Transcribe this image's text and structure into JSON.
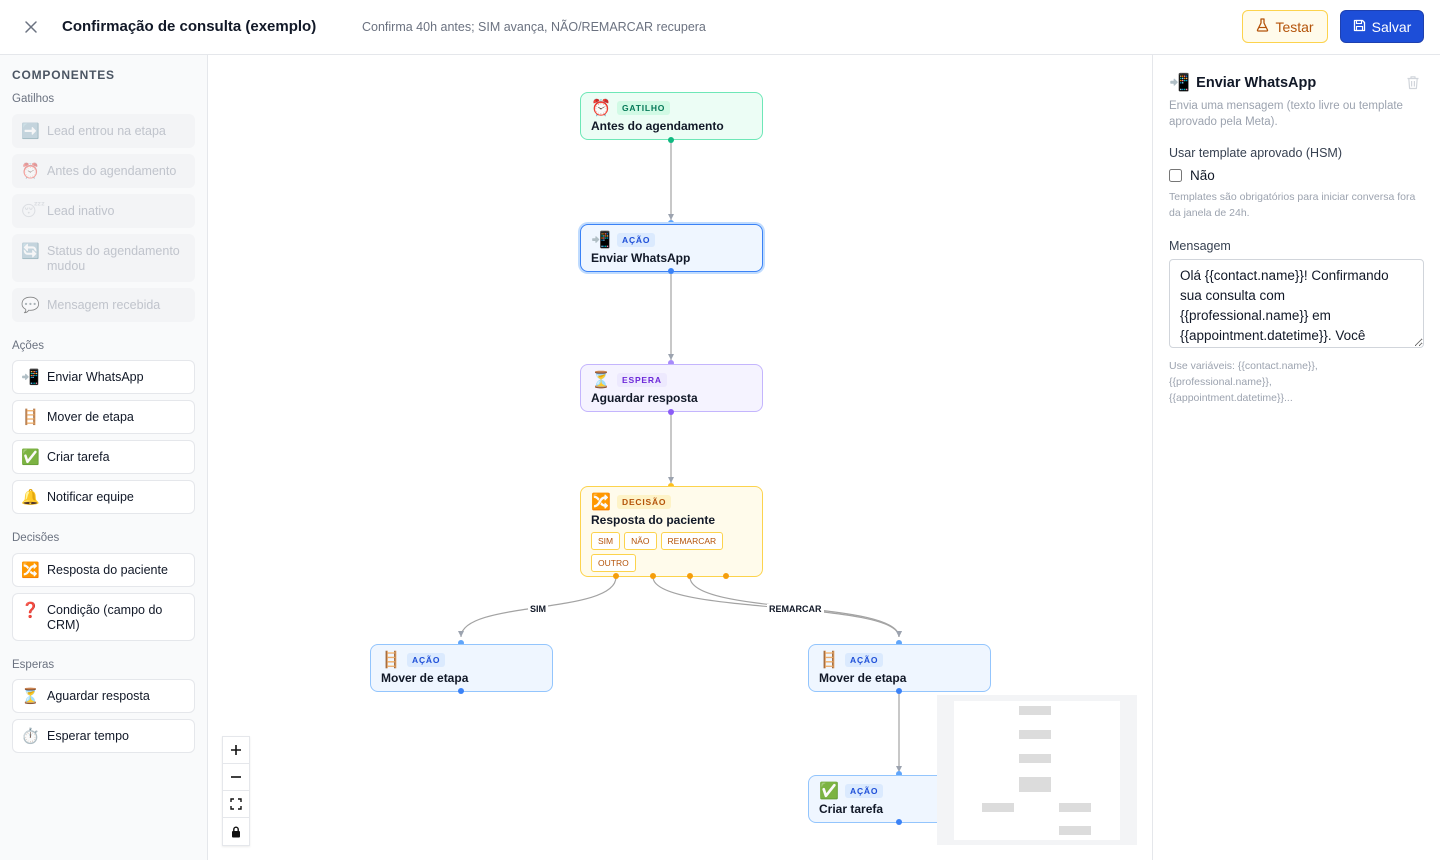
{
  "header": {
    "title": "Confirmação de consulta (exemplo)",
    "description": "Confirma 40h antes; SIM avança, NÃO/REMARCAR recupera",
    "test_label": "Testar",
    "save_label": "Salvar",
    "test_icon": "flask-icon",
    "save_icon": "floppy-disk-icon"
  },
  "palette": {
    "heading": "COMPONENTES",
    "groups": {
      "triggers": "Gatilhos",
      "actions": "Ações",
      "decisions": "Decisões",
      "waits": "Esperas"
    },
    "triggers": [
      {
        "icon": "➡️",
        "label": "Lead entrou na etapa"
      },
      {
        "icon": "⏰",
        "label": "Antes do agendamento"
      },
      {
        "icon": "😴",
        "label": "Lead inativo"
      },
      {
        "icon": "🔄",
        "label": "Status do agendamento mudou"
      },
      {
        "icon": "💬",
        "label": "Mensagem recebida"
      }
    ],
    "actions": [
      {
        "icon": "📲",
        "label": "Enviar WhatsApp"
      },
      {
        "icon": "🪜",
        "label": "Mover de etapa"
      },
      {
        "icon": "✅",
        "label": "Criar tarefa"
      },
      {
        "icon": "🔔",
        "label": "Notificar equipe"
      }
    ],
    "decisions": [
      {
        "icon": "🔀",
        "label": "Resposta do paciente"
      },
      {
        "icon": "❓",
        "label": "Condição (campo do CRM)"
      }
    ],
    "waits": [
      {
        "icon": "⏳",
        "label": "Aguardar resposta"
      },
      {
        "icon": "⏱️",
        "label": "Esperar tempo"
      }
    ]
  },
  "flow": {
    "trigger": {
      "icon": "⏰",
      "badge": "GATILHO",
      "title": "Antes do agendamento"
    },
    "send": {
      "icon": "📲",
      "badge": "AÇÃO",
      "title": "Enviar WhatsApp"
    },
    "wait": {
      "icon": "⏳",
      "badge": "ESPERA",
      "title": "Aguardar resposta"
    },
    "decision": {
      "icon": "🔀",
      "badge": "DECISÃO",
      "title": "Resposta do paciente",
      "options": [
        "SIM",
        "NÃO",
        "REMARCAR",
        "OUTRO"
      ]
    },
    "move_left": {
      "icon": "🪜",
      "badge": "AÇÃO",
      "title": "Mover de etapa"
    },
    "move_right": {
      "icon": "🪜",
      "badge": "AÇÃO",
      "title": "Mover de etapa"
    },
    "task": {
      "icon": "✅",
      "badge": "AÇÃO",
      "title": "Criar tarefa"
    },
    "edge_labels": {
      "sim": "SIM",
      "remarcar": "REMARCAR"
    }
  },
  "zoom_controls": [
    "zoom-in-icon",
    "zoom-out-icon",
    "fit-view-icon",
    "lock-icon"
  ],
  "panel": {
    "icon": "📲",
    "title": "Enviar WhatsApp",
    "description": "Envia uma mensagem (texto livre ou template aprovado pela Meta).",
    "template_label": "Usar template aprovado (HSM)",
    "template_value": "Não",
    "template_hint": "Templates são obrigatórios para iniciar conversa fora da janela de 24h.",
    "message_label": "Mensagem",
    "message_value": "Olá {{contact.name}}! Confirmando sua consulta com {{professional.name}} em {{appointment.datetime}}. Você",
    "variables_hint": "Use variáveis: {{contact.name}}, {{professional.name}}, {{appointment.datetime}}..."
  }
}
